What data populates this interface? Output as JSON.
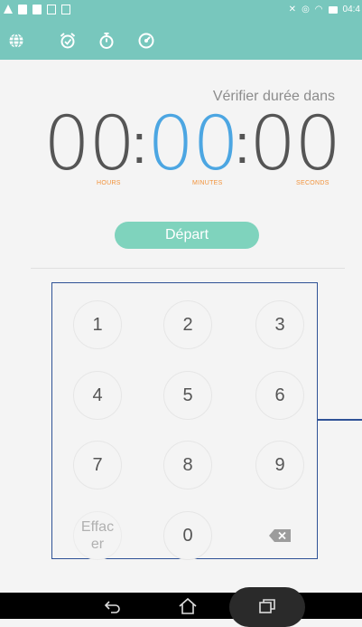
{
  "status_bar": {
    "time": "04:4"
  },
  "tabs": [
    {
      "id": "world-clock",
      "icon": "globe-icon"
    },
    {
      "id": "alarm",
      "icon": "alarm-clock-icon"
    },
    {
      "id": "stopwatch",
      "icon": "stopwatch-icon"
    },
    {
      "id": "timer",
      "icon": "timer-icon",
      "selected": true
    }
  ],
  "timer": {
    "header": "Vérifier durée dans",
    "hours": "00",
    "minutes": "00",
    "seconds": "00",
    "separator": ":",
    "hours_label": "HOURS",
    "minutes_label": "MINUTES",
    "seconds_label": "SECONDS",
    "start_label": "Départ"
  },
  "keypad": {
    "keys": [
      "1",
      "2",
      "3",
      "4",
      "5",
      "6",
      "7",
      "8",
      "9"
    ],
    "clear_line1": "Effac",
    "clear_line2": "er",
    "zero": "0",
    "backspace_icon": "backspace-icon"
  },
  "colors": {
    "accent": "#78c7bd",
    "button": "#7fd3bd",
    "minutes_digits": "#4ca6e2",
    "unit_labels": "#f2933b",
    "callout": "#2f5296"
  }
}
